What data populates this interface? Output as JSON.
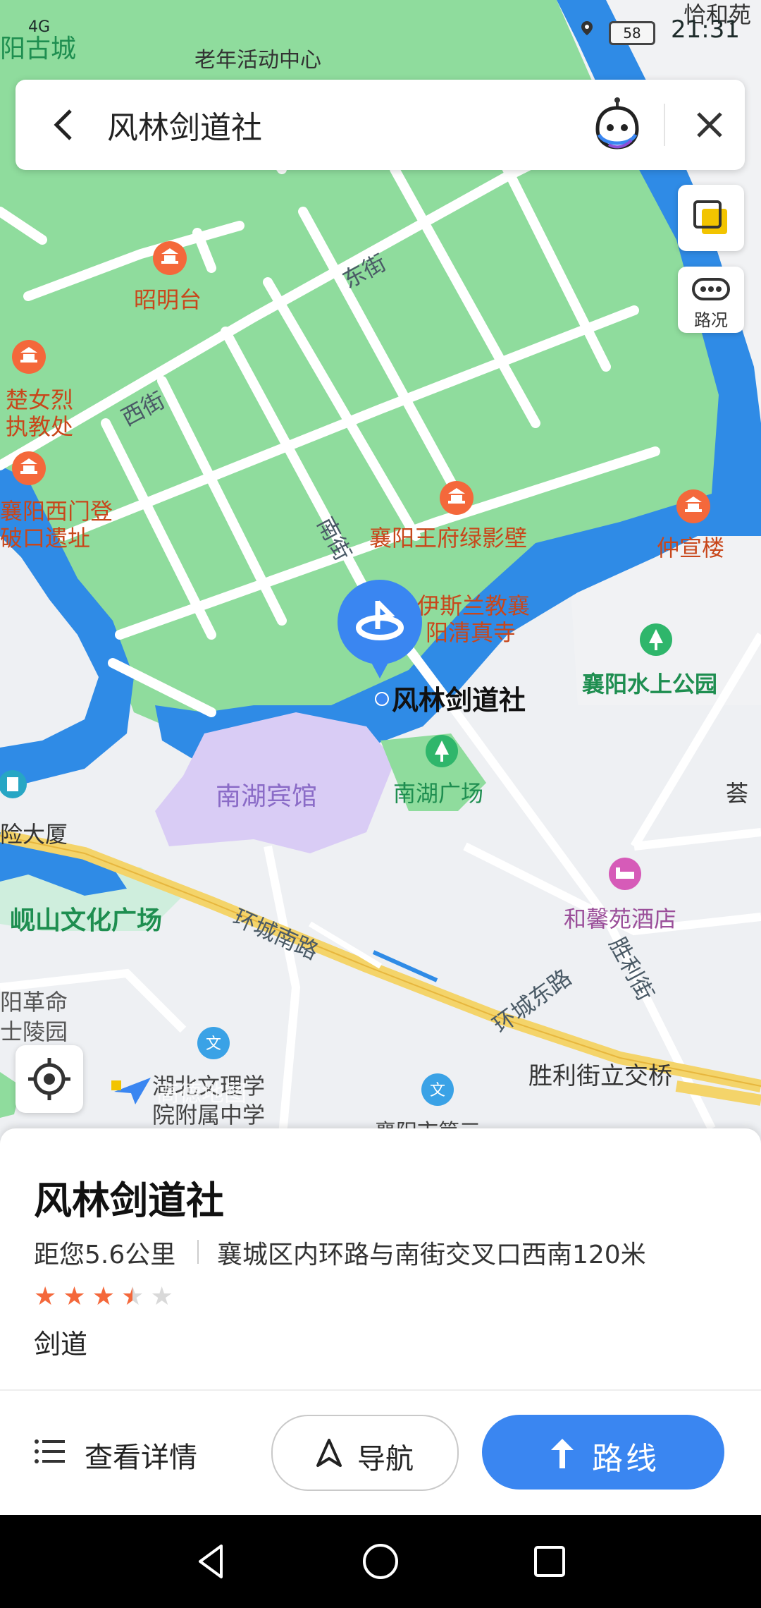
{
  "status_bar": {
    "time": "21:31",
    "battery": "58",
    "network": "4G"
  },
  "search": {
    "query": "风林剑道社"
  },
  "map_controls": {
    "traffic_label": "路况"
  },
  "map_labels": {
    "top_left": "阳古城",
    "top_center": "老年活动中心",
    "top_right": "恰和苑",
    "zhaomingtai": "昭明台",
    "chunv_1": "楚女烈",
    "chunv_2": "执教处",
    "ximen_1": "襄阳西门登",
    "ximen_2": "破口遗址",
    "wangfu": "襄阳王府绿影壁",
    "zhongxuan": "仲宣楼",
    "mosque_1": "伊斯兰教襄",
    "mosque_2": "阳清真寺",
    "selected": "风林剑道社",
    "water_park": "襄阳水上公园",
    "nanhu_hotel": "南湖宾馆",
    "nanhu_square": "南湖广场",
    "building": "险大厦",
    "xianshan": "岘山文化广场",
    "hexin": "和馨苑酒店",
    "martyrs_1": "阳革命",
    "martyrs_2": "士陵园",
    "school_1": "湖北文理学",
    "school_2": "院附属中学",
    "xiangyang_school": "襄阳市第三",
    "interchange": "胜利街立交桥",
    "right_edge": "荟",
    "watermark": "高德地图",
    "roads": {
      "dongjie": "东街",
      "xijie": "西街",
      "nanjie": "南街",
      "huanchengnan": "环城南路",
      "huanchengdong": "环城东路",
      "shenglijie": "胜利街"
    }
  },
  "place": {
    "name": "风林剑道社",
    "distance": "距您5.6公里",
    "address": "襄城区内环路与南街交叉口西南120米",
    "rating": 3.5,
    "category": "剑道"
  },
  "actions": {
    "details": "查看详情",
    "navigate": "导航",
    "route": "路线"
  },
  "colors": {
    "park_green": "#8fdc9d",
    "water": "#2f8be6",
    "road_yellow": "#f4d46a",
    "accent_blue": "#3a86f1",
    "star_orange": "#f4683b"
  }
}
